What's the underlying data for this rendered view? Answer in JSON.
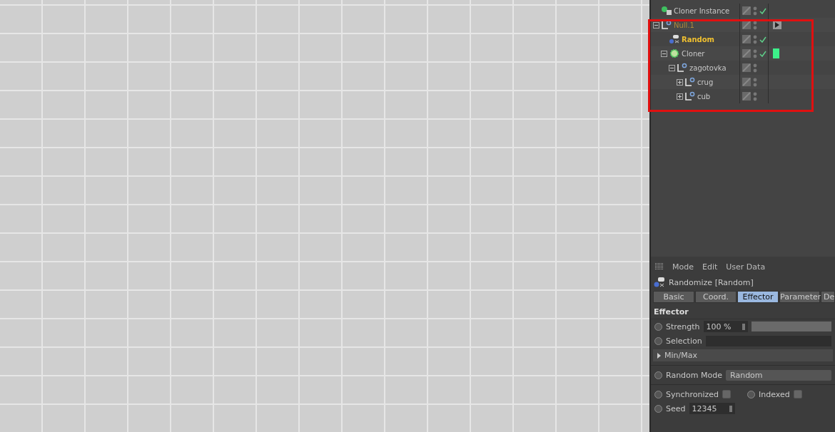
{
  "objects": [
    {
      "name": "Cloner Instance",
      "kind": "instance",
      "selected": false,
      "highlighted": false,
      "checked": true
    },
    {
      "name": "Null.1",
      "kind": "null",
      "selected": false,
      "highlighted": true,
      "checked": false,
      "tags": [
        {
          "kind": "display"
        }
      ],
      "expanded": true,
      "children": [
        {
          "name": "Random",
          "kind": "effector",
          "selected": true,
          "highlighted": false,
          "checked": true
        },
        {
          "name": "Cloner",
          "kind": "cloner",
          "selected": false,
          "highlighted": false,
          "checked": true,
          "tags": [
            {
              "kind": "green"
            }
          ],
          "expanded": true,
          "children": [
            {
              "name": "zagotovka",
              "kind": "null",
              "selected": false,
              "highlighted": false,
              "checked": false,
              "expanded": true,
              "children": [
                {
                  "name": "crug",
                  "kind": "null",
                  "selected": false,
                  "highlighted": false,
                  "checked": false,
                  "expanded": false
                },
                {
                  "name": "cub",
                  "kind": "null",
                  "selected": false,
                  "highlighted": false,
                  "checked": false,
                  "expanded": false
                }
              ]
            }
          ]
        }
      ]
    }
  ],
  "attributes": {
    "menu": [
      "Mode",
      "Edit",
      "User Data"
    ],
    "title": "Randomize [Random]",
    "tabs": [
      {
        "label": "Basic",
        "selected": false
      },
      {
        "label": "Coord.",
        "selected": false
      },
      {
        "label": "Effector",
        "selected": true
      },
      {
        "label": "Parameter",
        "selected": false
      },
      {
        "label": "De",
        "selected": false
      }
    ],
    "section": "Effector",
    "strength": {
      "label": "Strength",
      "value": "100 %",
      "level": 1
    },
    "selection": {
      "label": "Selection"
    },
    "group": {
      "label": "Min/Max",
      "expanded": false
    },
    "random_mode": {
      "label": "Random Mode",
      "value": "Random"
    },
    "synchronized": {
      "label": "Synchronized",
      "checked": false
    },
    "indexed": {
      "label": "Indexed",
      "checked": false
    },
    "seed": {
      "label": "Seed",
      "value": "12345"
    }
  }
}
